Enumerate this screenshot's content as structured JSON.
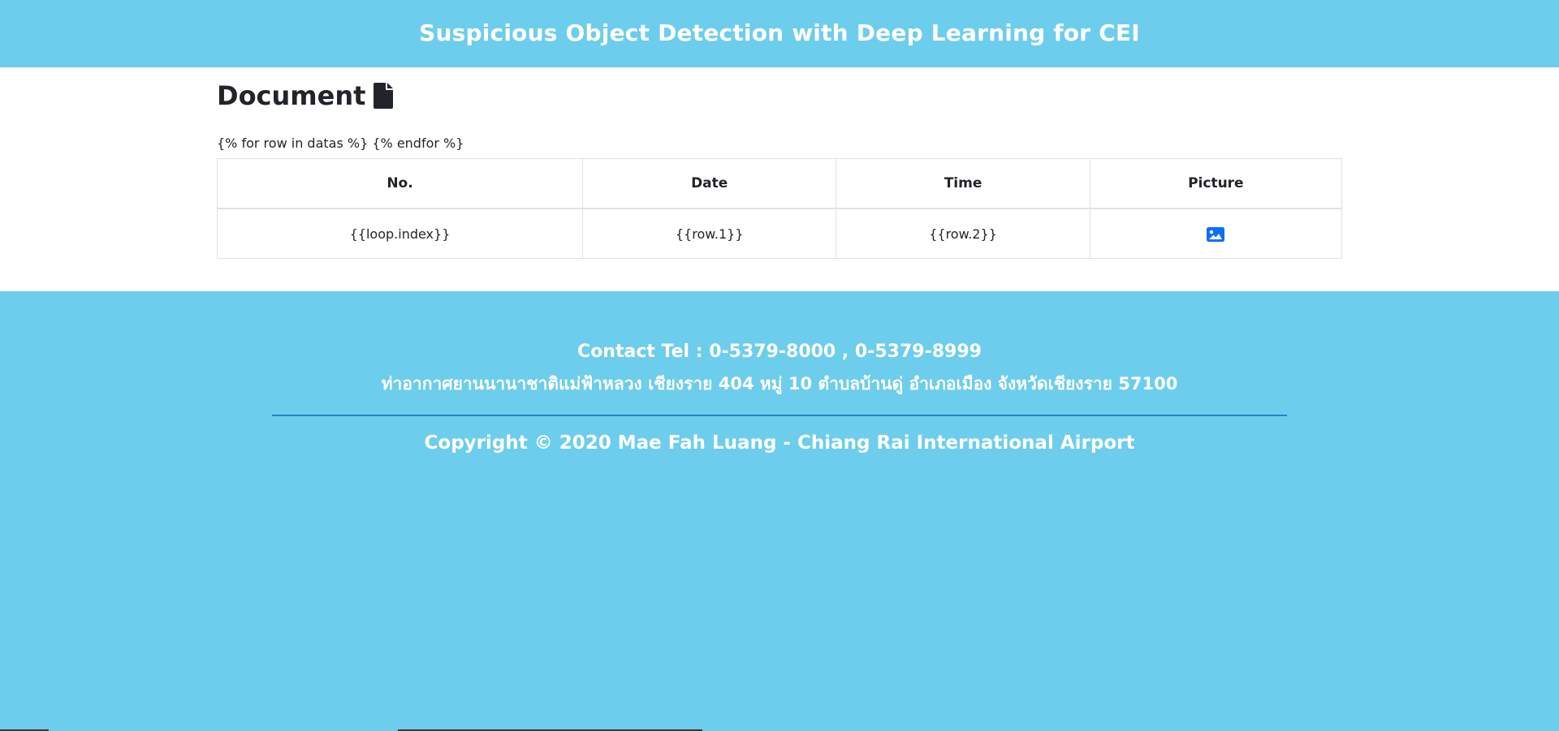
{
  "header": {
    "title": "Suspicious Object Detection with Deep Learning for CEI"
  },
  "document_section": {
    "heading": "Document",
    "heading_icon": "file-icon",
    "template_text": "{% for row in datas %} {% endfor %}"
  },
  "table": {
    "headers": [
      "No.",
      "Date",
      "Time",
      "Picture"
    ],
    "rows": [
      {
        "no": "{{loop.index}}",
        "date": "{{row.1}}",
        "time": "{{row.2}}",
        "picture_icon": "image-icon"
      }
    ]
  },
  "footer": {
    "contact": "Contact Tel : 0-5379-8000 , 0-5379-8999",
    "address": "ท่าอากาศยานนานาชาติแม่ฟ้าหลวง เชียงราย 404 หมู่ 10 ตำบลบ้านดู่ อำเภอเมือง จังหวัดเชียงราย 57100",
    "copyright": "Copyright © 2020 Mae Fah Luang - Chiang Rai International Airport"
  },
  "colors": {
    "brand_background": "#6dcdec",
    "divider": "#1f86c6",
    "icon_blue": "#0d6efd",
    "text_dark": "#212529"
  }
}
